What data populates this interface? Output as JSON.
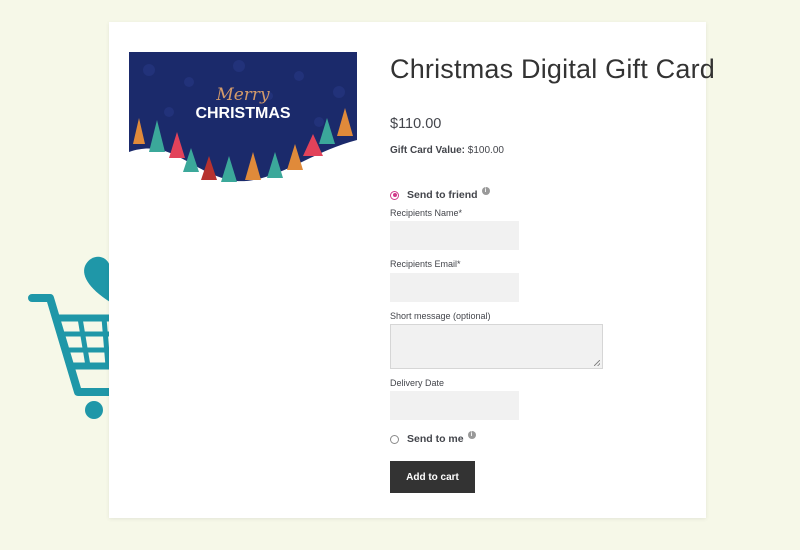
{
  "product": {
    "title": "Christmas Digital Gift Card",
    "price": "$110.00",
    "gift_card_value_label": "Gift Card Value:",
    "gift_card_value": "$100.00",
    "image_text_line1": "Merry",
    "image_text_line2": "CHRISTMAS"
  },
  "form": {
    "send_to_friend_label": "Send to friend",
    "send_to_friend_selected": true,
    "recipients_name_label": "Recipients Name*",
    "recipients_name_value": "",
    "recipients_email_label": "Recipients Email*",
    "recipients_email_value": "",
    "short_message_label": "Short message (optional)",
    "short_message_value": "",
    "delivery_date_label": "Delivery Date",
    "delivery_date_value": "",
    "send_to_me_label": "Send to me",
    "send_to_me_selected": false,
    "info_glyph": "i",
    "add_to_cart_label": "Add to cart"
  },
  "colors": {
    "page_background": "#f6f8e8",
    "button_background": "#333333",
    "radio_accent": "#d0398a",
    "cart_teal": "#1f97a8",
    "heart_dark_teal": "#166f7f",
    "arrow_lime": "#c3cf1f",
    "image_navy": "#1b2a6b"
  },
  "icons": {
    "info": "info-icon",
    "cart": "shopping-cart-icon",
    "heart": "heart-icon",
    "arrow": "curved-arrow-icon"
  }
}
